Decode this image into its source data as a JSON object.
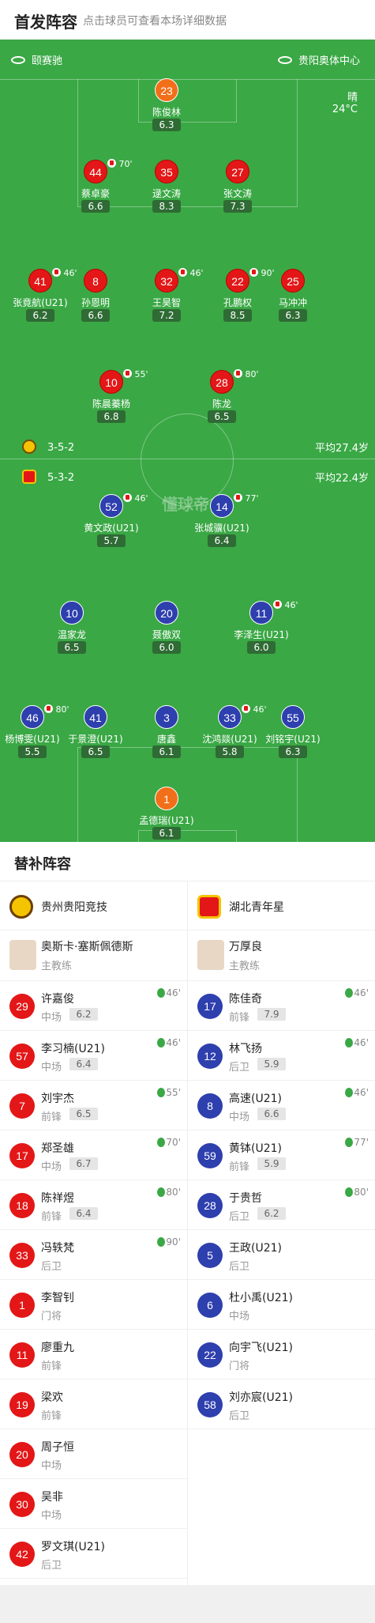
{
  "header": {
    "title": "首发阵容",
    "subtitle": "点击球员可查看本场详细数据"
  },
  "field": {
    "home_team": "颐赛驰",
    "venue": "贵阳奥体中心",
    "weather": "晴",
    "temperature": "24°C",
    "watermark": "懂球帝",
    "top_formation": "3-5-2",
    "top_avg_age": "平均27.4岁",
    "bottom_formation": "5-3-2",
    "bottom_avg_age": "平均22.4岁"
  },
  "top_players": [
    {
      "num": "23",
      "name": "陈俊林",
      "rating": "6.3",
      "color": "o"
    },
    {
      "num": "44",
      "name": "蔡卓豪",
      "rating": "6.6",
      "color": "r",
      "sub": "70'"
    },
    {
      "num": "35",
      "name": "逯文涛",
      "rating": "8.3",
      "color": "r"
    },
    {
      "num": "27",
      "name": "张文涛",
      "rating": "7.3",
      "color": "r"
    },
    {
      "num": "41",
      "name": "张竟航(U21)",
      "rating": "6.2",
      "color": "r",
      "sub": "46'"
    },
    {
      "num": "8",
      "name": "孙恩明",
      "rating": "6.6",
      "color": "r"
    },
    {
      "num": "32",
      "name": "王昊智",
      "rating": "7.2",
      "color": "r",
      "sub": "46'"
    },
    {
      "num": "22",
      "name": "孔鹏权",
      "rating": "8.5",
      "color": "r",
      "sub": "90'"
    },
    {
      "num": "25",
      "name": "马冲冲",
      "rating": "6.3",
      "color": "r"
    },
    {
      "num": "10",
      "name": "陈晨蓁杨",
      "rating": "6.8",
      "color": "r",
      "sub": "55'"
    },
    {
      "num": "28",
      "name": "陈龙",
      "rating": "6.5",
      "color": "r",
      "sub": "80'"
    }
  ],
  "bottom_players": [
    {
      "num": "52",
      "name": "黄文政(U21)",
      "rating": "5.7",
      "color": "b",
      "sub": "46'"
    },
    {
      "num": "14",
      "name": "张城骥(U21)",
      "rating": "6.4",
      "color": "b",
      "sub": "77'"
    },
    {
      "num": "10",
      "name": "温家龙",
      "rating": "6.5",
      "color": "b"
    },
    {
      "num": "20",
      "name": "聂傲双",
      "rating": "6.0",
      "color": "b"
    },
    {
      "num": "11",
      "name": "李泽生(U21)",
      "rating": "6.0",
      "color": "b",
      "sub": "46'"
    },
    {
      "num": "46",
      "name": "杨博雯(U21)",
      "rating": "5.5",
      "color": "b",
      "sub": "80'"
    },
    {
      "num": "41",
      "name": "于景澄(U21)",
      "rating": "6.5",
      "color": "b"
    },
    {
      "num": "3",
      "name": "唐鑫",
      "rating": "6.1",
      "color": "b"
    },
    {
      "num": "33",
      "name": "沈鸿燚(U21)",
      "rating": "5.8",
      "color": "b",
      "sub": "46'"
    },
    {
      "num": "55",
      "name": "刘铭宇(U21)",
      "rating": "6.3",
      "color": "b"
    },
    {
      "num": "1",
      "name": "孟德瑞(U21)",
      "rating": "6.1",
      "color": "o"
    }
  ],
  "subs": {
    "title": "替补阵容",
    "left": {
      "team": "贵州贵阳竞技",
      "coach_name": "奥斯卡·塞斯佩德斯",
      "coach_role": "主教练",
      "players": [
        {
          "num": "29",
          "name": "许嘉俊",
          "pos": "中场",
          "rating": "6.2",
          "min": "46'"
        },
        {
          "num": "57",
          "name": "李习楠(U21)",
          "pos": "中场",
          "rating": "6.4",
          "min": "46'"
        },
        {
          "num": "7",
          "name": "刘宇杰",
          "pos": "前锋",
          "rating": "6.5",
          "min": "55'"
        },
        {
          "num": "17",
          "name": "郑圣雄",
          "pos": "中场",
          "rating": "6.7",
          "min": "70'"
        },
        {
          "num": "18",
          "name": "陈祥煜",
          "pos": "前锋",
          "rating": "6.4",
          "min": "80'"
        },
        {
          "num": "33",
          "name": "冯轶梵",
          "pos": "后卫",
          "rating": "",
          "min": "90'"
        },
        {
          "num": "1",
          "name": "李智钊",
          "pos": "门将",
          "rating": "",
          "min": ""
        },
        {
          "num": "11",
          "name": "廖重九",
          "pos": "前锋",
          "rating": "",
          "min": ""
        },
        {
          "num": "19",
          "name": "梁欢",
          "pos": "前锋",
          "rating": "",
          "min": ""
        },
        {
          "num": "20",
          "name": "周子恒",
          "pos": "中场",
          "rating": "",
          "min": ""
        },
        {
          "num": "30",
          "name": "吴非",
          "pos": "中场",
          "rating": "",
          "min": ""
        },
        {
          "num": "42",
          "name": "罗文琪(U21)",
          "pos": "后卫",
          "rating": "",
          "min": ""
        }
      ]
    },
    "right": {
      "team": "湖北青年星",
      "coach_name": "万厚良",
      "coach_role": "主教练",
      "players": [
        {
          "num": "17",
          "name": "陈佳奇",
          "pos": "前锋",
          "rating": "7.9",
          "min": "46'"
        },
        {
          "num": "12",
          "name": "林飞扬",
          "pos": "后卫",
          "rating": "5.9",
          "min": "46'"
        },
        {
          "num": "8",
          "name": "高速(U21)",
          "pos": "中场",
          "rating": "6.6",
          "min": "46'"
        },
        {
          "num": "59",
          "name": "黄钵(U21)",
          "pos": "前锋",
          "rating": "5.9",
          "min": "77'"
        },
        {
          "num": "28",
          "name": "于贵哲",
          "pos": "后卫",
          "rating": "6.2",
          "min": "80'"
        },
        {
          "num": "5",
          "name": "王政(U21)",
          "pos": "后卫",
          "rating": "",
          "min": ""
        },
        {
          "num": "6",
          "name": "杜小禹(U21)",
          "pos": "中场",
          "rating": "",
          "min": ""
        },
        {
          "num": "22",
          "name": "向宇飞(U21)",
          "pos": "门将",
          "rating": "",
          "min": ""
        },
        {
          "num": "58",
          "name": "刘亦宸(U21)",
          "pos": "后卫",
          "rating": "",
          "min": ""
        }
      ]
    }
  }
}
